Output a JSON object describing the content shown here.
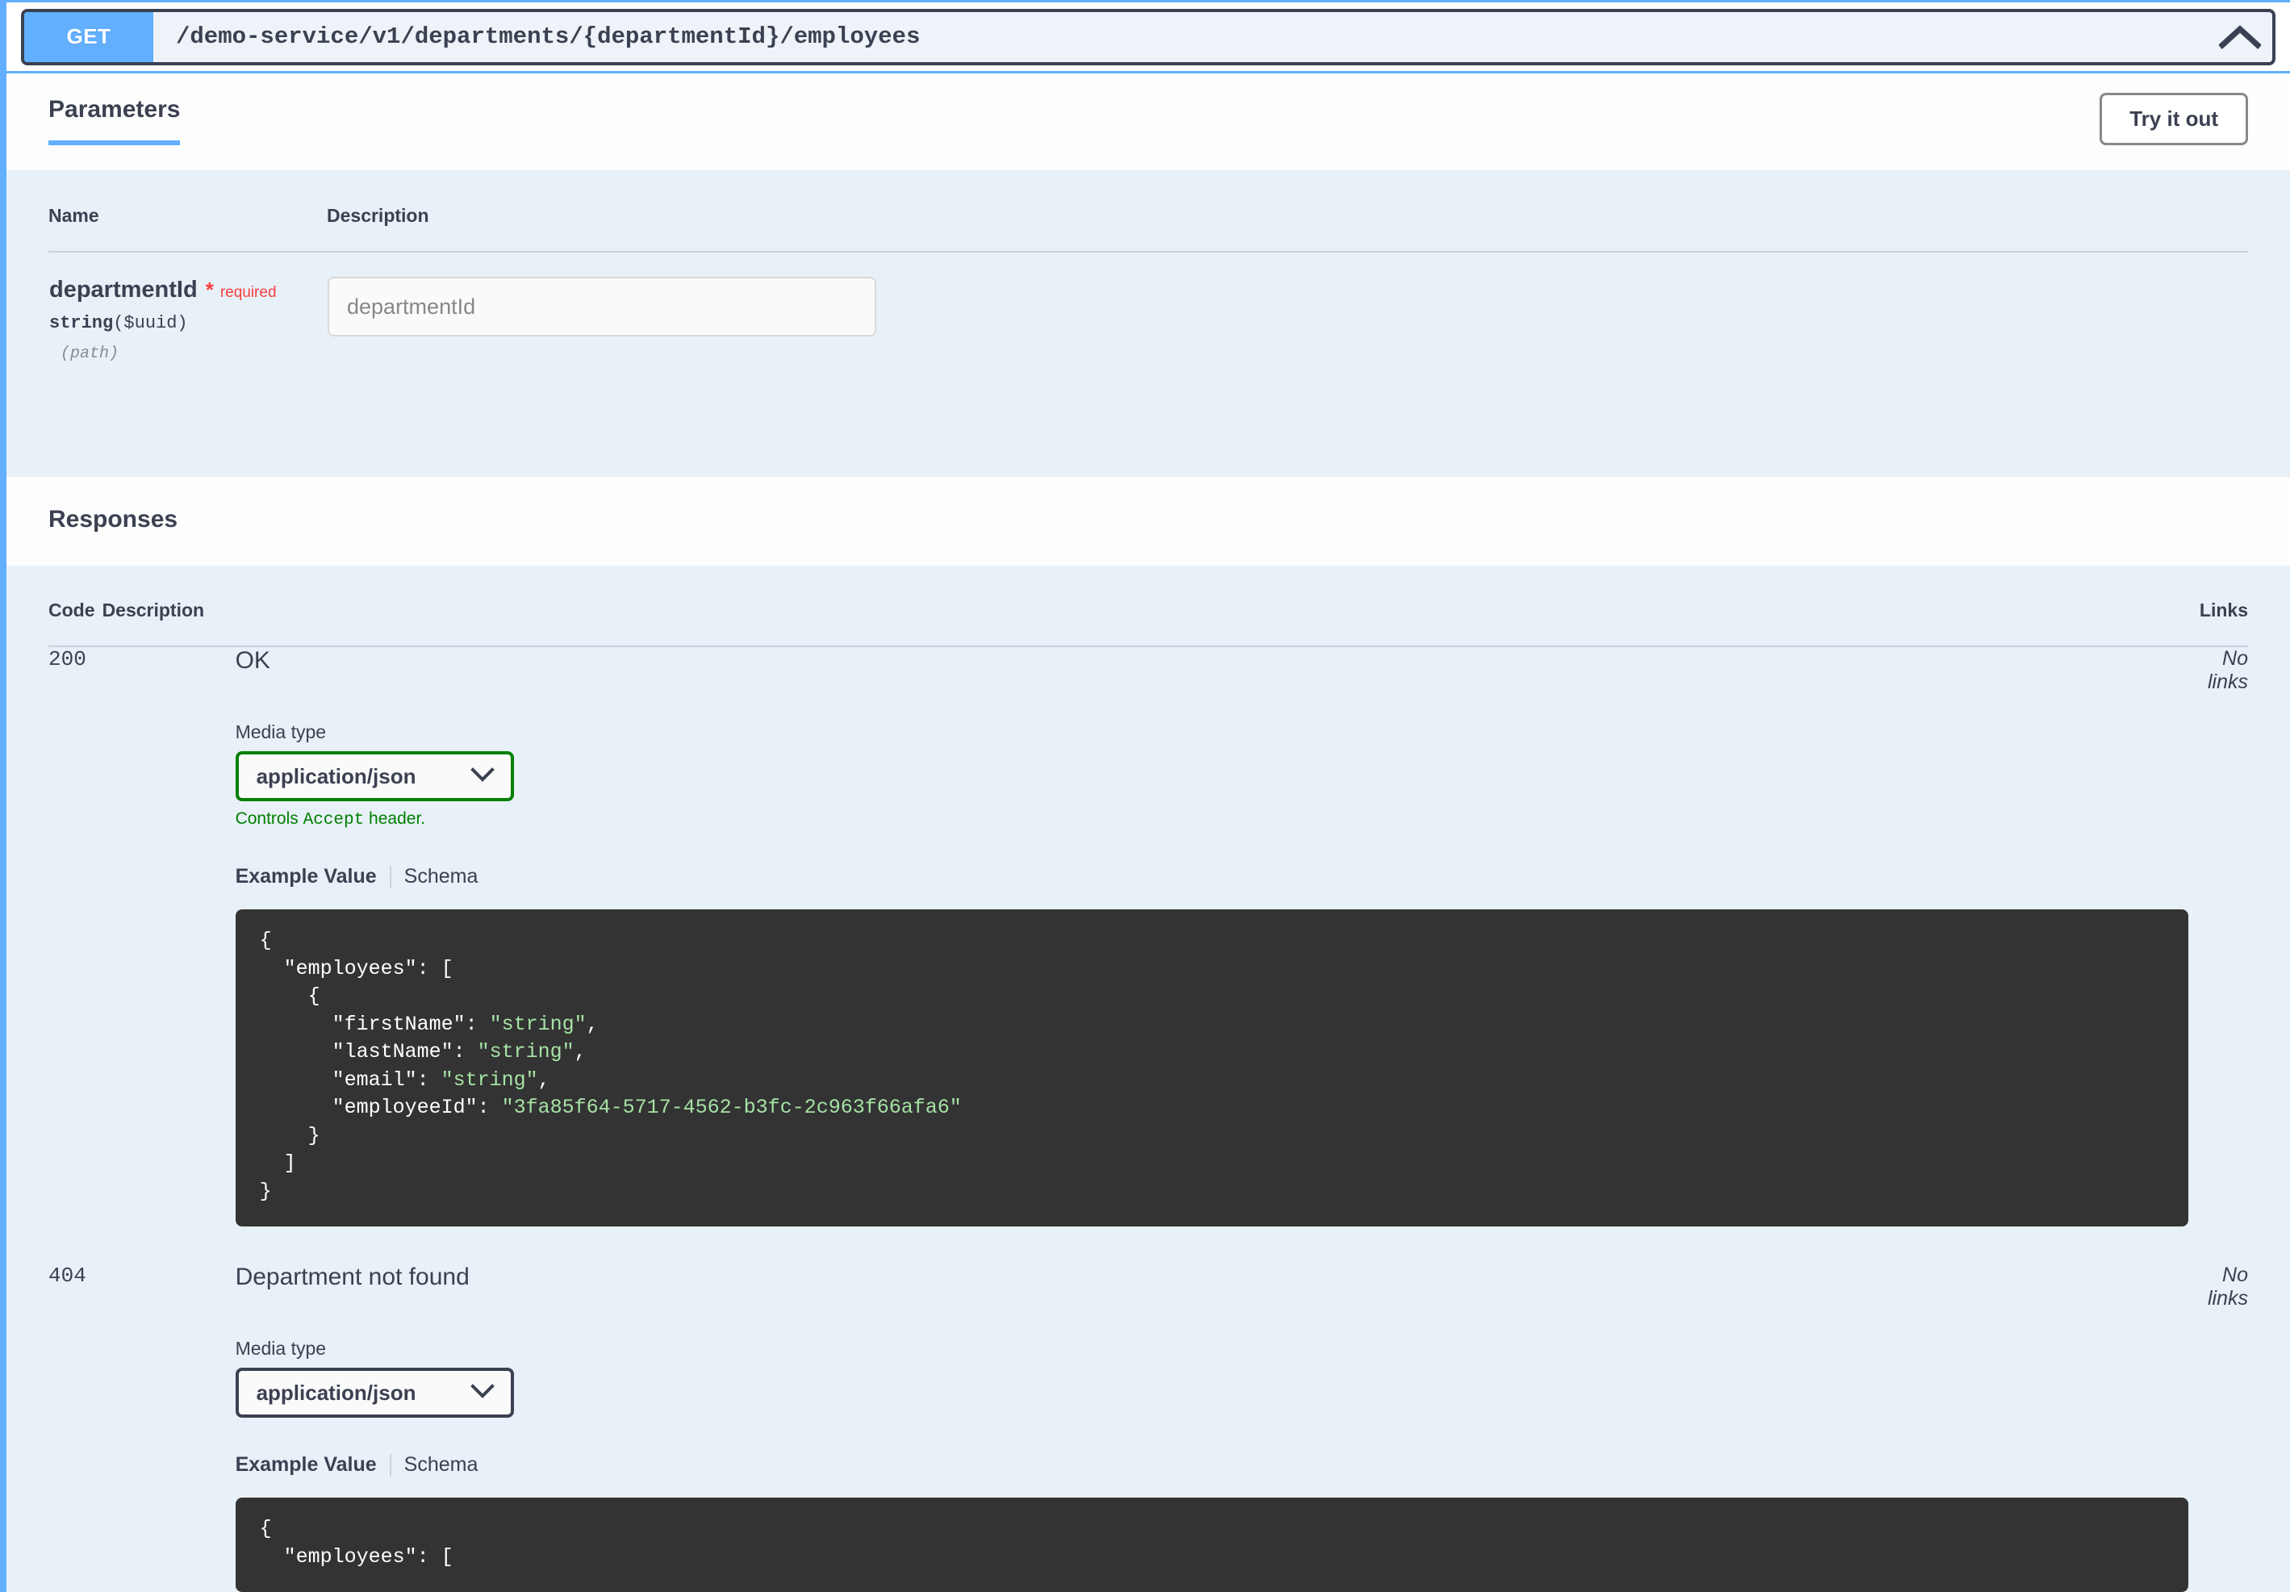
{
  "operation": {
    "method": "GET",
    "path": "/demo-service/v1/departments/{departmentId}/employees",
    "collapse_icon": "chevron-up-icon",
    "method_color": "#61affe"
  },
  "parameters_section": {
    "tab_label": "Parameters",
    "try_it_out_label": "Try it out",
    "columns": {
      "name": "Name",
      "description": "Description"
    },
    "rows": [
      {
        "name": "departmentId",
        "required_star": "*",
        "required_label": "required",
        "type": "string",
        "format": "($uuid)",
        "location": "(path)",
        "input_placeholder": "departmentId",
        "input_value": ""
      }
    ]
  },
  "responses_section": {
    "title": "Responses",
    "columns": {
      "code": "Code",
      "description": "Description",
      "links": "Links"
    },
    "rows": [
      {
        "code": "200",
        "description": "OK",
        "links": "No links",
        "media_type_label": "Media type",
        "media_type_value": "application/json",
        "media_type_accepted": true,
        "accept_note_prefix": "Controls ",
        "accept_note_mono": "Accept",
        "accept_note_suffix": " header.",
        "example_tab": "Example Value",
        "schema_tab": "Schema",
        "example_lines": [
          {
            "text": "{"
          },
          {
            "text": "  \"employees\": ["
          },
          {
            "text": "    {"
          },
          {
            "text": "      \"firstName\": ",
            "value": "\"string\"",
            "tail": ","
          },
          {
            "text": "      \"lastName\": ",
            "value": "\"string\"",
            "tail": ","
          },
          {
            "text": "      \"email\": ",
            "value": "\"string\"",
            "tail": ","
          },
          {
            "text": "      \"employeeId\": ",
            "value": "\"3fa85f64-5717-4562-b3fc-2c963f66afa6\"",
            "tail": ""
          },
          {
            "text": "    }"
          },
          {
            "text": "  ]"
          },
          {
            "text": "}"
          }
        ]
      },
      {
        "code": "404",
        "description": "Department not found",
        "links": "No links",
        "media_type_label": "Media type",
        "media_type_value": "application/json",
        "media_type_accepted": false,
        "accept_note_prefix": "",
        "accept_note_mono": "",
        "accept_note_suffix": "",
        "example_tab": "Example Value",
        "schema_tab": "Schema",
        "example_lines": [
          {
            "text": "{"
          },
          {
            "text": "  \"employees\": ["
          }
        ]
      }
    ]
  },
  "icons": {
    "chevron_down": "chevron-down-icon",
    "chevron_up": "chevron-up-icon"
  }
}
